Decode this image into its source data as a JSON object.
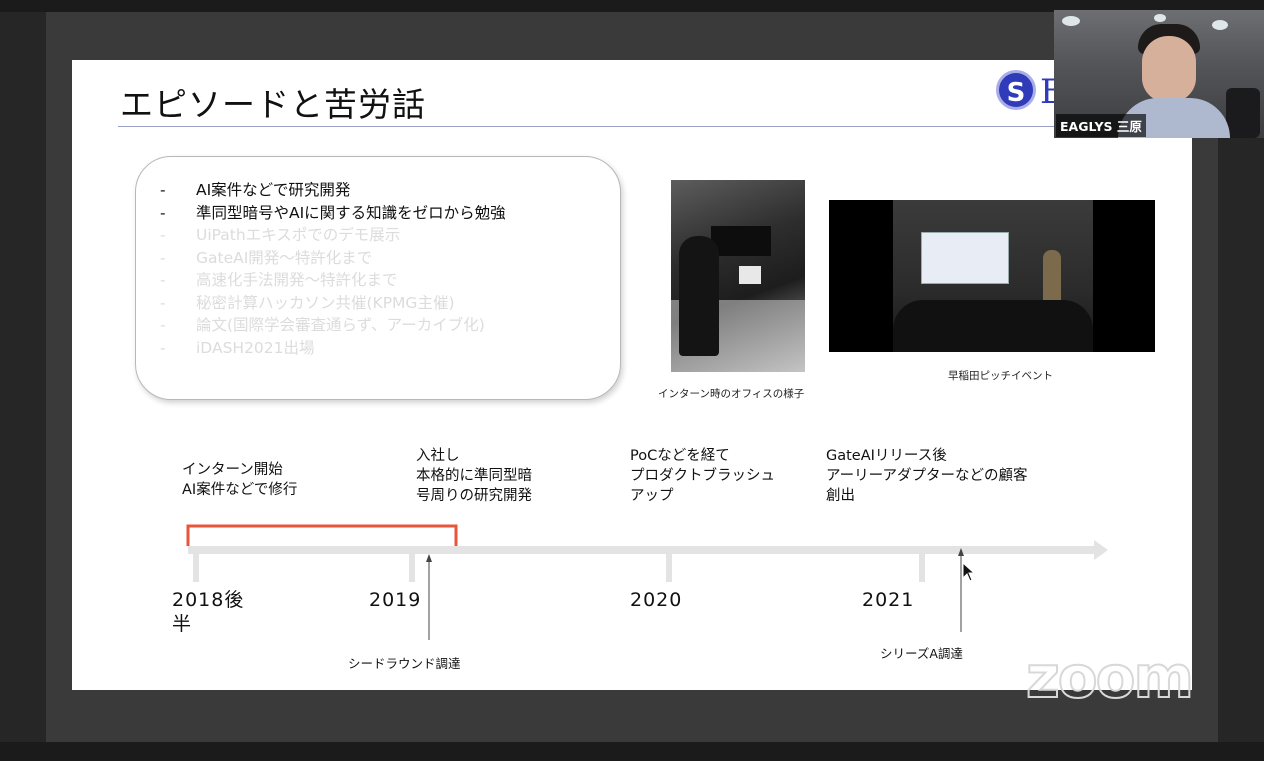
{
  "slide": {
    "title": "エピソードと苦労話",
    "logo_initial": "S",
    "logo_text": "E",
    "bullets": [
      {
        "dash": "-",
        "text": "AI案件などで研究開発",
        "faded": false
      },
      {
        "dash": "-",
        "text": "準同型暗号やAIに関する知識をゼロから勉強",
        "faded": false
      },
      {
        "dash": "-",
        "text": "UiPathエキスポでのデモ展示",
        "faded": true
      },
      {
        "dash": "-",
        "text": "GateAI開発～特許化まで",
        "faded": true
      },
      {
        "dash": "-",
        "text": "高速化手法開発～特許化まで",
        "faded": true
      },
      {
        "dash": "-",
        "text": "秘密計算ハッカソン共催(KPMG主催)",
        "faded": true
      },
      {
        "dash": "-",
        "text": "論文(国際学会審査通らず、アーカイブ化)",
        "faded": true
      },
      {
        "dash": "-",
        "text": "iDASH2021出場",
        "faded": true
      }
    ],
    "photos": {
      "office_caption": "インターン時のオフィスの様子",
      "pitch_caption": "早稲田ピッチイベント"
    },
    "timeline": {
      "events": [
        {
          "lines": [
            "インターン開始",
            "AI案件などで修行"
          ]
        },
        {
          "lines": [
            "入社し",
            "本格的に準同型暗",
            "号周りの研究開発"
          ]
        },
        {
          "lines": [
            "PoCなどを経て",
            "プロダクトブラッシュ",
            "アップ"
          ]
        },
        {
          "lines": [
            "GateAIリリース後",
            "アーリーアダプターなどの顧客",
            "創出"
          ]
        }
      ],
      "years": [
        {
          "lines": [
            "2018後",
            "半"
          ]
        },
        {
          "lines": [
            "2019"
          ]
        },
        {
          "lines": [
            "2020"
          ]
        },
        {
          "lines": [
            "2021"
          ]
        }
      ],
      "funding": [
        {
          "label": "シードラウンド調達"
        },
        {
          "label": "シリーズA調達"
        }
      ],
      "colors": {
        "bracket": "#e8553a",
        "arrow": "#e3e3e3"
      }
    }
  },
  "webcam": {
    "participant_name": "EAGLYS 三原"
  },
  "zoom_watermark": "zoom"
}
